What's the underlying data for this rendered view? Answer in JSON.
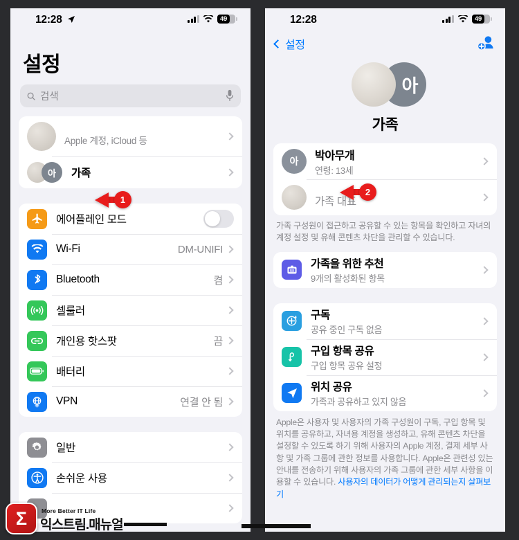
{
  "statusbar": {
    "time": "12:28",
    "battery_percent": "49",
    "location_icon": "location-arrow-icon",
    "cellular_icon": "cellular-bars-icon",
    "wifi_icon": "wifi-icon"
  },
  "left_phone": {
    "title": "설정",
    "search": {
      "placeholder": "검색",
      "icon": "search-icon",
      "mic_icon": "microphone-icon"
    },
    "account_group": [
      {
        "id": "apple-account",
        "title": "",
        "subtitle": "Apple 계정, iCloud 등",
        "avatar": "user-photo-avatar",
        "accessory": "chevron"
      },
      {
        "id": "family",
        "title": "가족",
        "subtitle": "",
        "avatar_initial": "아",
        "accessory": "chevron"
      }
    ],
    "connectivity_group": [
      {
        "id": "airplane-mode",
        "label": "에어플레인 모드",
        "value": "",
        "icon": "airplane-icon",
        "color": "#f59a17",
        "accessory": "toggle",
        "toggle_on": false
      },
      {
        "id": "wifi",
        "label": "Wi-Fi",
        "value": "DM-UNIFI",
        "icon": "wifi-icon",
        "color": "#1079f2",
        "accessory": "chevron"
      },
      {
        "id": "bluetooth",
        "label": "Bluetooth",
        "value": "켬",
        "icon": "bluetooth-icon",
        "color": "#1079f2",
        "accessory": "chevron"
      },
      {
        "id": "cellular",
        "label": "셀룰러",
        "value": "",
        "icon": "cellular-antenna-icon",
        "color": "#34c759",
        "accessory": "chevron"
      },
      {
        "id": "personal-hotspot",
        "label": "개인용 핫스팟",
        "value": "끔",
        "icon": "hotspot-link-icon",
        "color": "#34c759",
        "accessory": "chevron"
      },
      {
        "id": "battery",
        "label": "배터리",
        "value": "",
        "icon": "battery-icon",
        "color": "#34c759",
        "accessory": "chevron"
      },
      {
        "id": "vpn",
        "label": "VPN",
        "value": "연결 안 됨",
        "icon": "vpn-globe-icon",
        "color": "#1079f2",
        "accessory": "chevron"
      }
    ],
    "system_group": [
      {
        "id": "general",
        "label": "일반",
        "value": "",
        "icon": "gear-icon",
        "color": "#8e8e93",
        "accessory": "chevron"
      },
      {
        "id": "accessibility",
        "label": "손쉬운 사용",
        "value": "",
        "icon": "accessibility-icon",
        "color": "#1079f2",
        "accessory": "chevron"
      },
      {
        "id": "obscured-item",
        "label": "",
        "value": "",
        "icon": "obscured-icon",
        "color": "#8e8e93",
        "accessory": "chevron"
      }
    ]
  },
  "right_phone": {
    "nav": {
      "back_label": "설정",
      "back_icon": "chevron-left-icon",
      "add_member_icon": "add-person-icon"
    },
    "hero": {
      "title": "가족",
      "avatar_initial": "아"
    },
    "members": [
      {
        "id": "member-child",
        "name": "박아무개",
        "sub": "연령: 13세",
        "initial": "아",
        "accessory": "chevron"
      },
      {
        "id": "member-organizer",
        "name": "",
        "sub": "가족 대표",
        "initial": "",
        "accessory": "chevron"
      }
    ],
    "members_footnote": "가족 구성원이 접근하고 공유할 수 있는 항목을 확인하고 자녀의 계정 설정 및 유해 콘텐츠 차단을 관리할 수 있습니다.",
    "recommend_group": [
      {
        "id": "family-recommendations",
        "title": "가족을 위한 추천",
        "sub": "9개의 활성화된 항목",
        "icon": "family-suggestions-icon",
        "color": "#5e5ce6",
        "accessory": "chevron"
      }
    ],
    "sharing_group": [
      {
        "id": "subscriptions",
        "title": "구독",
        "sub": "공유 중인 구독 없음",
        "icon": "subscriptions-icon",
        "color": "#2a9fe0",
        "accessory": "chevron"
      },
      {
        "id": "purchase-sharing",
        "title": "구입 항목 공유",
        "sub": "구입 항목 공유 설정",
        "icon": "purchase-sharing-icon",
        "color": "#17c3a8",
        "accessory": "chevron"
      },
      {
        "id": "location-sharing",
        "title": "위치 공유",
        "sub": "가족과 공유하고 있지 않음",
        "icon": "location-arrow-icon",
        "color": "#1079f2",
        "accessory": "chevron"
      }
    ],
    "privacy_footnote_part1": "Apple은 사용자 및 사용자의 가족 구성원이 구독, 구입 항목 및 위치를 공유하고, 자녀용 계정을 생성하고, 유해 콘텐츠 차단을 설정할 수 있도록 하기 위해 사용자의 Apple 계정, 결제 세부 사항 및 가족 그룹에 관한 정보를 사용합니다. Apple은 관련성 있는 안내를 전송하기 위해 사용자의 가족 그룹에 관한 세부 사항을 이용할 수 있습니다. ",
    "privacy_link": "사용자의 데이터가 어떻게 관리되는지 살펴보기"
  },
  "callouts": [
    {
      "id": "callout-1",
      "number": "1"
    },
    {
      "id": "callout-2",
      "number": "2"
    }
  ],
  "watermark": {
    "tagline": "More Better IT Life",
    "brand": "익스트림.매뉴얼",
    "logo_glyph": "Σ"
  },
  "colors": {
    "accent_blue": "#007aff",
    "callout_red": "#e81c1c",
    "page_bg": "#f2f2f7",
    "frame": "#2a2b2e"
  }
}
